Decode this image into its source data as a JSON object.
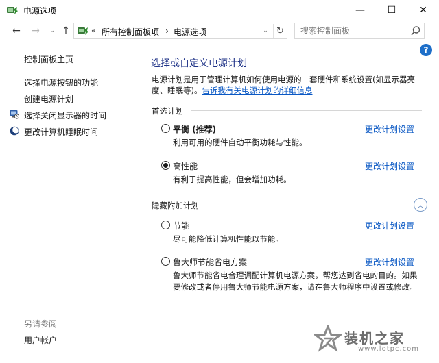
{
  "window": {
    "title": "电源选项",
    "minimize_glyph": "—",
    "maximize_glyph": "☐",
    "close_glyph": "✕"
  },
  "address_bar": {
    "chevron": "«",
    "path": [
      "所有控制面板项",
      "电源选项"
    ],
    "separator": "›"
  },
  "search": {
    "placeholder": "搜索控制面板"
  },
  "left_nav": {
    "home": "控制面板主页",
    "items": [
      {
        "label": "选择电源按钮的功能"
      },
      {
        "label": "创建电源计划"
      },
      {
        "label": "选择关闭显示器的时间",
        "icon": "display-clock-icon"
      },
      {
        "label": "更改计算机睡眠时间",
        "icon": "moon-icon"
      }
    ],
    "see_also_heading": "另请参阅",
    "see_also_items": [
      {
        "label": "用户帐户"
      }
    ]
  },
  "main": {
    "title": "选择或自定义电源计划",
    "description": "电源计划是用于管理计算机如何使用电源的一套硬件和系统设置(如显示器亮度、睡眠等)。",
    "description_link": "告诉我有关电源计划的详细信息",
    "preferred_heading": "首选计划",
    "hidden_heading": "隐藏附加计划",
    "change_link": "更改计划设置",
    "plans": [
      {
        "name": "平衡 (推荐)",
        "desc": "利用可用的硬件自动平衡功耗与性能。",
        "selected": false,
        "bold": true
      },
      {
        "name": "高性能",
        "desc": "有利于提高性能，但会增加功耗。",
        "selected": true,
        "bold": false
      },
      {
        "name": "节能",
        "desc": "尽可能降低计算机性能以节能。",
        "selected": false,
        "bold": false
      },
      {
        "name": "鲁大师节能省电方案",
        "desc": "鲁大师节能省电合理调配计算机电源方案，帮您达到省电的目的。如果要修改或者停用鲁大师节能电源方案，请在鲁大师程序中设置或修改。",
        "selected": false,
        "bold": false
      }
    ]
  },
  "help": {
    "glyph": "?"
  },
  "watermark": {
    "name": "装机之家",
    "url": "www.lotpc.com"
  },
  "colors": {
    "title_blue": "#1e3287",
    "link_blue": "#0a58c4",
    "help_blue": "#1e6fc9"
  }
}
